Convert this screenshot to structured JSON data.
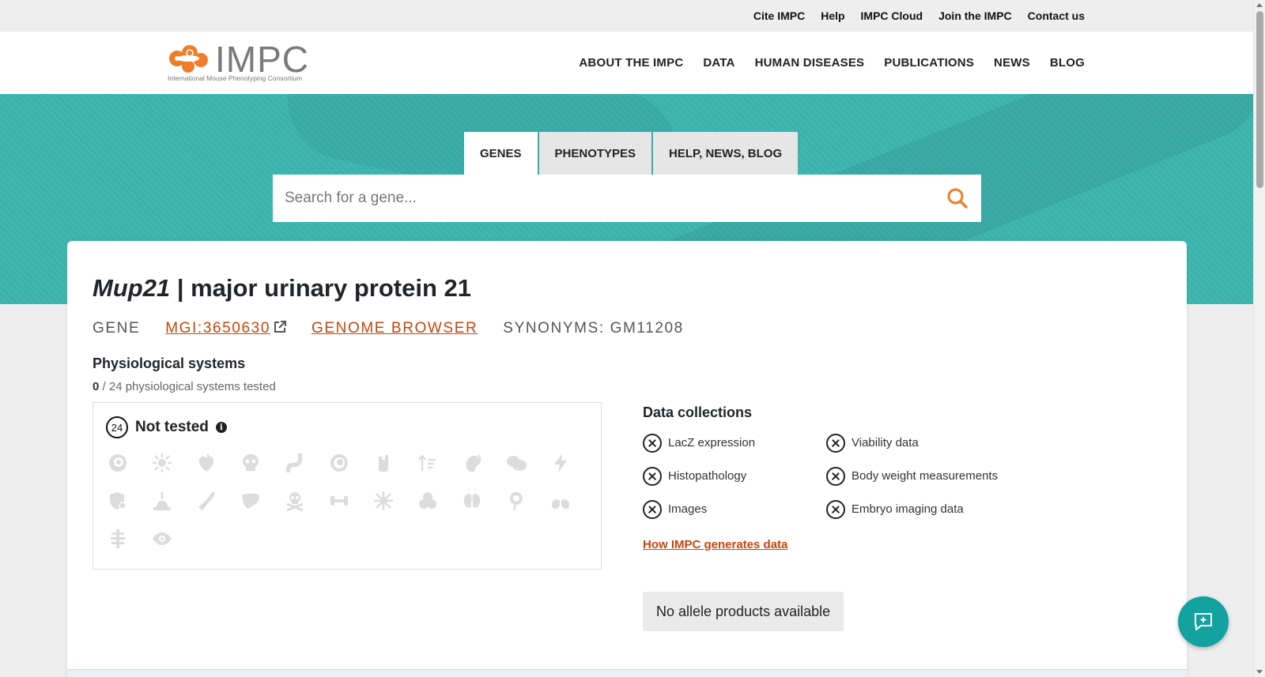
{
  "topbar": {
    "links": [
      "Cite IMPC",
      "Help",
      "IMPC Cloud",
      "Join the IMPC",
      "Contact us"
    ]
  },
  "header": {
    "logo_text": "IMPC",
    "logo_subtitle": "International Mouse Phenotyping Consortium",
    "nav": [
      "ABOUT THE IMPC",
      "DATA",
      "HUMAN DISEASES",
      "PUBLICATIONS",
      "NEWS",
      "BLOG"
    ]
  },
  "search": {
    "tabs": [
      "GENES",
      "PHENOTYPES",
      "HELP, NEWS, BLOG"
    ],
    "active_tab": "GENES",
    "placeholder": "Search for a gene...",
    "value": ""
  },
  "gene": {
    "symbol": "Mup21",
    "name": "| major urinary protein 21",
    "type_label": "GENE",
    "mgi_id": "MGI:3650630",
    "genome_browser": "GENOME BROWSER",
    "synonyms": "SYNONYMS: GM11208"
  },
  "physiological": {
    "heading": "Physiological systems",
    "tested_count": "0",
    "tested_suffix": " / 24 physiological systems tested",
    "not_tested_count": "24",
    "not_tested_label": "Not tested",
    "icons": [
      "immune-system-icon",
      "hematopoietic-icon",
      "cardiovascular-icon",
      "skeleton-icon",
      "digestive-icon",
      "embryo-icon",
      "renal-icon",
      "growth-icon",
      "hearing-icon",
      "behavior-icon",
      "nervous-system-icon",
      "immunity-icon",
      "integument-icon",
      "limbs-icon",
      "liver-icon",
      "mortality-icon",
      "muscle-icon",
      "homeostasis-icon",
      "pigmentation-icon",
      "reproductive-icon",
      "endocrine-icon",
      "respiratory-icon",
      "adipose-icon",
      "vision-icon"
    ]
  },
  "data_collections": {
    "heading": "Data collections",
    "items": [
      "LacZ expression",
      "Viability data",
      "Histopathology",
      "Body weight measurements",
      "Images",
      "Embryo imaging data"
    ],
    "link": "How IMPC generates data"
  },
  "allele": {
    "label": "No allele products available"
  },
  "colors": {
    "accent": "#c4450c",
    "hero": "#3bb3ad",
    "chat": "#12a2a0",
    "icon_gray": "#dcdcdc"
  }
}
